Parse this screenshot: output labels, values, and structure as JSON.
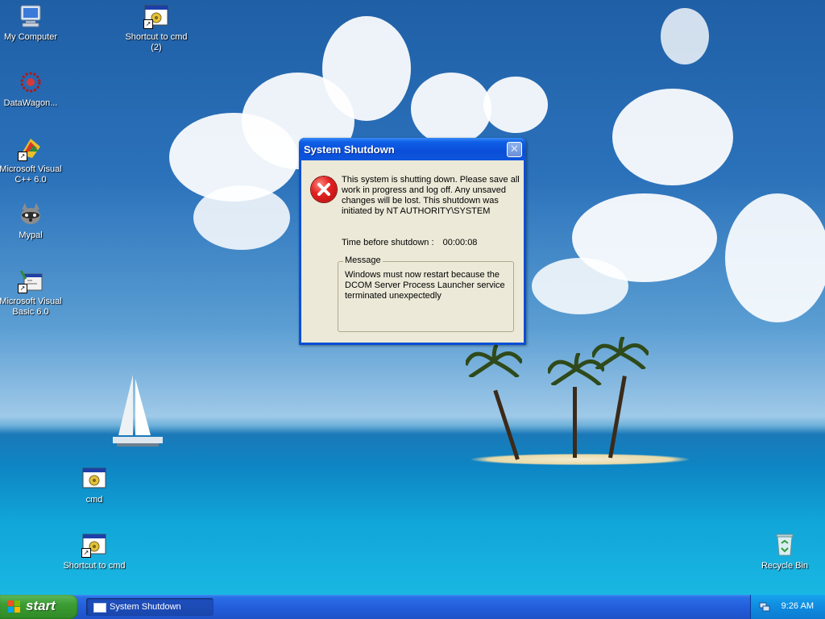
{
  "desktop_icons": [
    {
      "name": "my-computer",
      "label": "My Computer"
    },
    {
      "name": "datawagon",
      "label": "DataWagon..."
    },
    {
      "name": "msvc",
      "label": "Microsoft Visual C++ 6.0"
    },
    {
      "name": "mypal",
      "label": "Mypal"
    },
    {
      "name": "msvb",
      "label": "Microsoft Visual Basic 6.0"
    },
    {
      "name": "shortcut-cmd-2",
      "label": "Shortcut to cmd (2)"
    },
    {
      "name": "cmd",
      "label": "cmd"
    },
    {
      "name": "shortcut-cmd",
      "label": "Shortcut to cmd"
    },
    {
      "name": "recycle-bin",
      "label": "Recycle Bin"
    }
  ],
  "dialog": {
    "title": "System Shutdown",
    "close_glyph": "✕",
    "icon": "error-icon",
    "message": "This system is shutting down. Please save all work in progress and log off. Any unsaved changes will be lost. This shutdown was initiated by NT AUTHORITY\\SYSTEM",
    "time_label": "Time before shutdown :",
    "time_value": "00:00:08",
    "message_group_label": "Message",
    "message_group_text": "Windows must now restart because the DCOM Server Process Launcher service terminated unexpectedly"
  },
  "taskbar": {
    "start_label": "start",
    "task_label": "System Shutdown",
    "clock": "9:26 AM"
  },
  "colors": {
    "title_bar": "#0a4fd6",
    "dialog_body": "#ece9d8",
    "start_green": "#3c9c33",
    "taskbar_blue": "#245edb",
    "tray_blue": "#0f8be0"
  }
}
